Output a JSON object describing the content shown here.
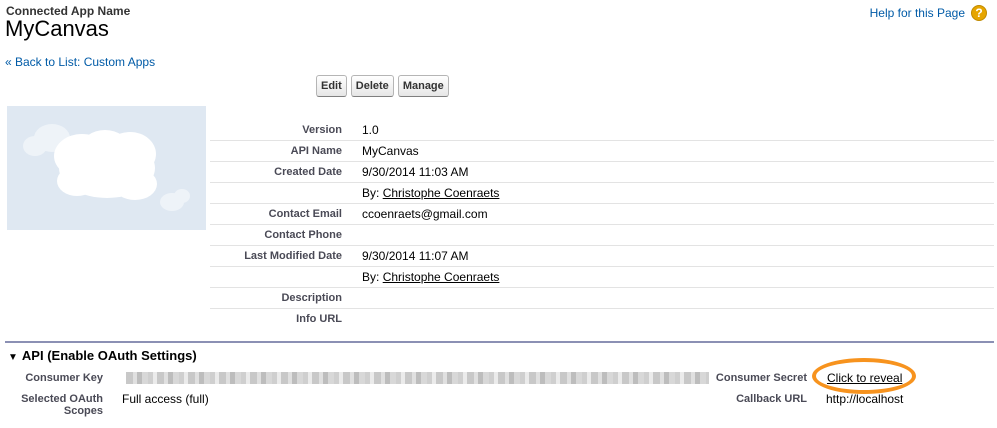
{
  "header": {
    "subtitle": "Connected App Name",
    "title": "MyCanvas",
    "help_link": "Help for this Page",
    "help_icon": "?"
  },
  "back_link": "« Back to List: Custom Apps",
  "buttons": {
    "edit": "Edit",
    "delete": "Delete",
    "manage": "Manage"
  },
  "details": {
    "version_label": "Version",
    "version": "1.0",
    "api_name_label": "API Name",
    "api_name": "MyCanvas",
    "created_date_label": "Created Date",
    "created_date": "9/30/2014 11:03 AM",
    "created_by_prefix": "By:",
    "created_by": "Christophe Coenraets",
    "contact_email_label": "Contact Email",
    "contact_email": "ccoenraets@gmail.com",
    "contact_phone_label": "Contact Phone",
    "contact_phone": "",
    "last_modified_label": "Last Modified Date",
    "last_modified": "9/30/2014 11:07 AM",
    "modified_by_prefix": "By:",
    "modified_by": "Christophe Coenraets",
    "description_label": "Description",
    "description": "",
    "info_url_label": "Info URL",
    "info_url": ""
  },
  "api_section": {
    "title": "API (Enable OAuth Settings)",
    "consumer_key_label": "Consumer Key",
    "consumer_secret_label": "Consumer Secret",
    "reveal_link": "Click to reveal",
    "scopes_label_line1": "Selected OAuth",
    "scopes_label_line2": "Scopes",
    "scopes_value": "Full access (full)",
    "callback_label": "Callback URL",
    "callback_value": "http://localhost"
  },
  "colors": {
    "link": "#015ba7",
    "highlight": "#f7931e",
    "section_rule": "#8b90b4"
  }
}
